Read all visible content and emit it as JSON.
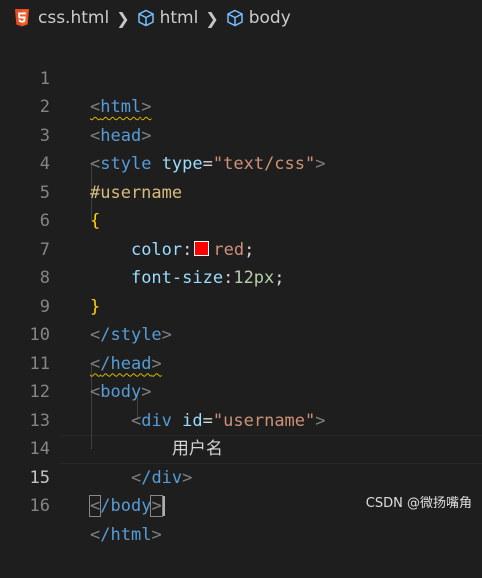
{
  "breadcrumb": {
    "file": "css.html",
    "items": [
      "html",
      "body"
    ]
  },
  "lines": [
    {
      "n": "1",
      "tag": "html"
    },
    {
      "n": "2",
      "tag": "head"
    },
    {
      "n": "3",
      "tag": "style",
      "attr": "type",
      "value": "\"text/css\""
    },
    {
      "n": "4",
      "selector": "#username"
    },
    {
      "n": "5",
      "brace": "{"
    },
    {
      "n": "6",
      "prop": "color",
      "value": "red"
    },
    {
      "n": "7",
      "prop": "font-size",
      "value": "12px"
    },
    {
      "n": "8",
      "brace": "}"
    },
    {
      "n": "9",
      "tag": "/style"
    },
    {
      "n": "10",
      "tag": "/head"
    },
    {
      "n": "11",
      "tag": "body"
    },
    {
      "n": "12",
      "tag": "div",
      "attr": "id",
      "value": "\"username\""
    },
    {
      "n": "13",
      "text": "用户名"
    },
    {
      "n": "14",
      "tag": "/div"
    },
    {
      "n": "15",
      "tag": "/body"
    },
    {
      "n": "16",
      "tag": "/html"
    }
  ],
  "colors": {
    "swatch": "#ff0000",
    "background": "#1e1e1e",
    "tag": "#569cd6",
    "attr": "#9cdcfe",
    "string": "#ce9178",
    "selector": "#d7ba7d"
  },
  "icons": {
    "file": "html5-icon",
    "symbol": "cube-icon",
    "separator": "chevron-right-icon"
  },
  "watermark": "CSDN @微扬嘴角"
}
